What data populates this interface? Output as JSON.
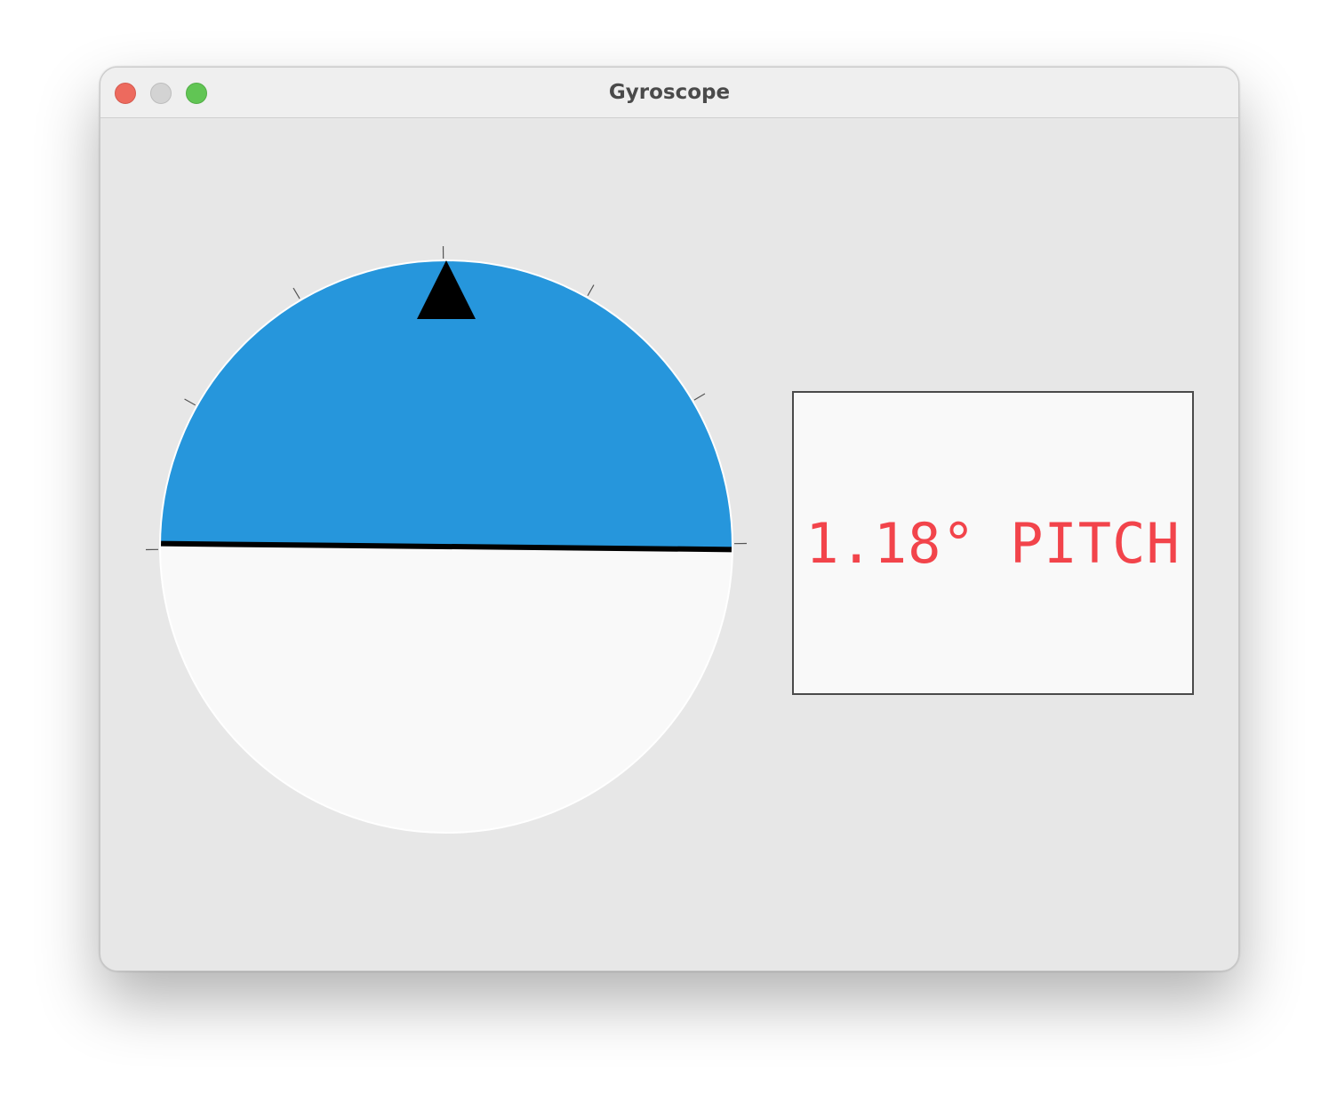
{
  "window": {
    "title": "Gyroscope"
  },
  "readout": {
    "value": "1.18° PITCH"
  },
  "gyro": {
    "pitch_deg": 1.18,
    "tick_angles_deg": [
      -90,
      -60,
      -30,
      0,
      30,
      60,
      90
    ],
    "colors": {
      "sky": "#2696dc",
      "ground": "#f9f9f9",
      "horizon": "#000000",
      "pointer": "#000000",
      "tick": "#555555"
    }
  }
}
